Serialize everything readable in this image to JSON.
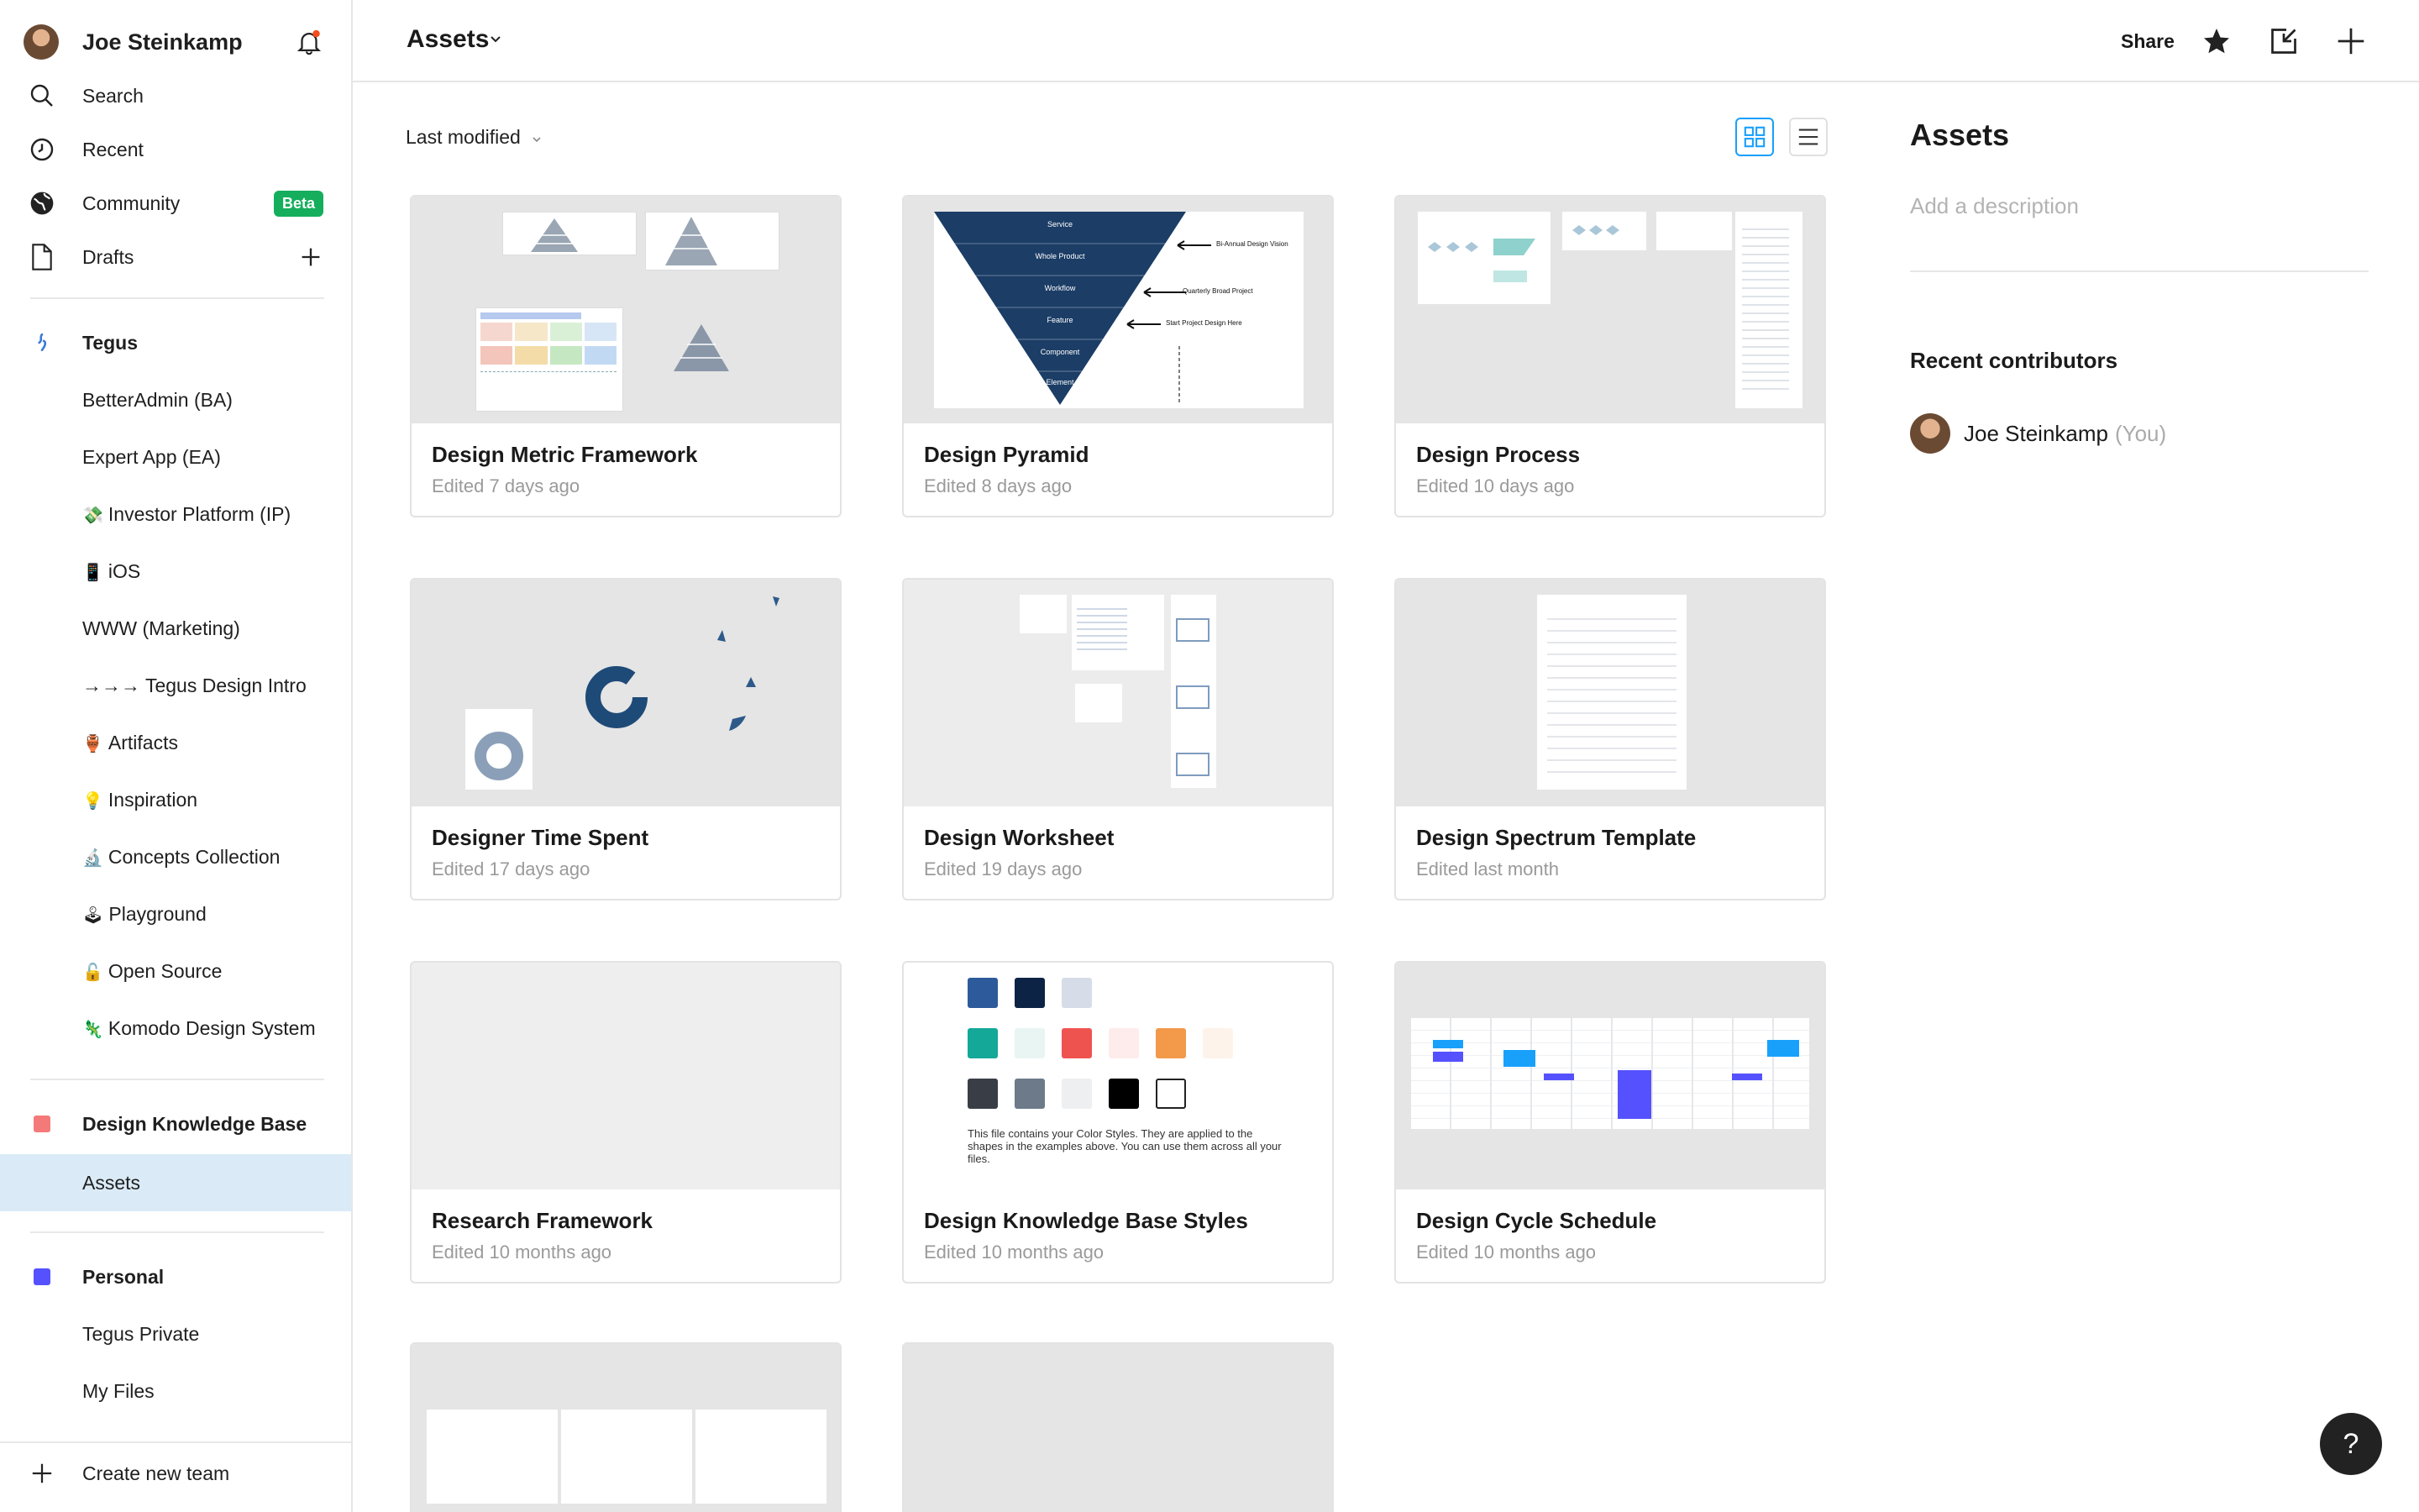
{
  "sidebar": {
    "user_name": "Joe Steinkamp",
    "nav": [
      {
        "label": "Search",
        "icon": "search-icon"
      },
      {
        "label": "Recent",
        "icon": "clock-icon"
      },
      {
        "label": "Community",
        "icon": "globe-icon",
        "badge": "Beta"
      },
      {
        "label": "Drafts",
        "icon": "file-icon"
      }
    ],
    "team1": {
      "name": "Tegus",
      "projects": [
        {
          "emoji": "",
          "label": "BetterAdmin (BA)"
        },
        {
          "emoji": "",
          "label": "Expert App (EA)"
        },
        {
          "emoji": "💸",
          "label": "Investor Platform (IP)"
        },
        {
          "emoji": "📱",
          "label": "iOS"
        },
        {
          "emoji": "",
          "label": "WWW (Marketing)"
        },
        {
          "emoji": "",
          "label": "→→→ Tegus Design Intro"
        },
        {
          "emoji": "🏺",
          "label": "Artifacts"
        },
        {
          "emoji": "💡",
          "label": "Inspiration"
        },
        {
          "emoji": "🔬",
          "label": "Concepts Collection"
        },
        {
          "emoji": "🕹",
          "label": "Playground"
        },
        {
          "emoji": "🔓",
          "label": "Open Source"
        },
        {
          "emoji": "🦎",
          "label": "Komodo Design System"
        }
      ]
    },
    "team2": {
      "name": "Design Knowledge Base",
      "color": "#f24e4e",
      "projects": [
        {
          "label": "Assets"
        }
      ]
    },
    "team3": {
      "name": "Personal",
      "color": "#5551ff",
      "projects": [
        {
          "label": "Tegus Private"
        },
        {
          "label": "My Files"
        }
      ]
    },
    "create_team": "Create new team",
    "selected_color": "#daebf7"
  },
  "topbar": {
    "title": "Assets",
    "share": "Share"
  },
  "main": {
    "sort_label": "Last modified",
    "files": [
      {
        "title": "Design Metric Framework",
        "edited": "Edited 7 days ago"
      },
      {
        "title": "Design Pyramid",
        "edited": "Edited 8 days ago"
      },
      {
        "title": "Design Process",
        "edited": "Edited 10 days ago"
      },
      {
        "title": "Designer Time Spent",
        "edited": "Edited 17 days ago"
      },
      {
        "title": "Design Worksheet",
        "edited": "Edited 19 days ago"
      },
      {
        "title": "Design Spectrum Template",
        "edited": "Edited last month"
      },
      {
        "title": "Research Framework",
        "edited": "Edited 10 months ago"
      },
      {
        "title": "Design Knowledge Base Styles",
        "edited": "Edited 10 months ago"
      },
      {
        "title": "Design Cycle Schedule",
        "edited": "Edited 10 months ago"
      }
    ],
    "pyramid_levels": [
      "Service",
      "Whole Product",
      "Workflow",
      "Feature",
      "Component",
      "Element"
    ],
    "pyramid_notes": [
      "Bi-Annual Design Vision",
      "Quarterly Broad Project",
      "Start Project Design Here"
    ],
    "styles_note": "This file contains your Color Styles. They are applied to the shapes in the examples above. You can use them across all your files.",
    "swatches": [
      [
        "#2d5a9b",
        "#0d2345",
        "#d6dde8"
      ],
      [
        "#14a899",
        "#e8f5f3",
        "#ef5350",
        "#fdeceb",
        "#f2994a",
        "#fdf3ea"
      ],
      [
        "#393e46",
        "#6c7a89",
        "#eeeff1",
        "#000000",
        "#ffffff"
      ]
    ]
  },
  "right_panel": {
    "title": "Assets",
    "description_placeholder": "Add a description",
    "contributors_heading": "Recent contributors",
    "contributor_name": "Joe Steinkamp",
    "contributor_tag": "(You)"
  },
  "help_label": "?"
}
